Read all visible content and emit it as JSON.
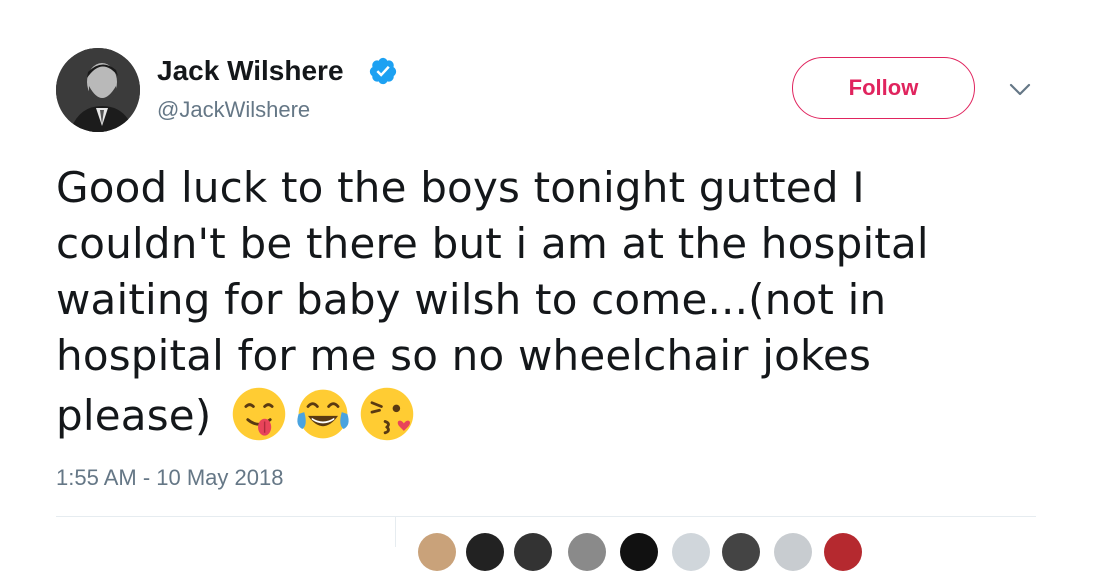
{
  "user": {
    "name": "Jack Wilshere",
    "handle": "@JackWilshere",
    "verified": true
  },
  "actions": {
    "follow_label": "Follow"
  },
  "tweet": {
    "lines": [
      "Good luck to the boys tonight gutted I",
      "couldn't be there but i am at the hospital",
      "waiting for baby wilsh to come...(not in",
      "hospital for me so no wheelchair jokes",
      "please)"
    ],
    "emojis": [
      "yum-face-emoji",
      "tears-of-joy-emoji",
      "kissing-wink-emoji"
    ],
    "timestamp": "1:55 AM - 10 May 2018"
  },
  "colors": {
    "follow": "#e0245e",
    "verified": "#1da1f2",
    "secondary_text": "#657786",
    "divider": "#e6ecf0"
  }
}
